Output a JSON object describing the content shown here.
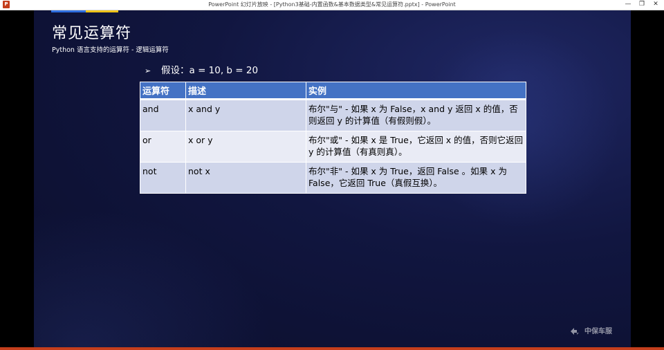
{
  "window": {
    "title": "PowerPoint 幻灯片放映 - [Python3基础-内置函数&基本数据类型&常见运算符.pptx] - PowerPoint",
    "app_icon": "P",
    "controls": {
      "minimize": "—",
      "restore": "❐",
      "close": "✕"
    }
  },
  "slide": {
    "title": "常见运算符",
    "subtitle": "Python 语言支持的运算符 - 逻辑运算符",
    "bullet": {
      "marker": "➢",
      "text": "假设：a = 10, b = 20"
    },
    "table": {
      "headers": [
        "运算符",
        "描述",
        "实例"
      ],
      "rows": [
        [
          "and",
          "x and y",
          "布尔\"与\" - 如果 x 为 False，x and y 返回 x 的值，否则返回 y 的计算值（有假则假）。"
        ],
        [
          "or",
          "x or y",
          "布尔\"或\" - 如果 x 是 True，它返回 x 的值，否则它返回 y 的计算值（有真则真）。"
        ],
        [
          "not",
          "not x",
          "布尔\"非\" - 如果 x 为 True，返回 False 。如果 x 为 False，它返回 True（真假互换）。"
        ]
      ]
    },
    "watermark": "中保车服"
  },
  "colors": {
    "header_blue": "#4472c4",
    "row_odd": "#cfd5ea",
    "row_even": "#e9ebf5",
    "accent_blue": "#2f6fe0",
    "accent_yellow": "#f0c419",
    "statusbar": "#c43e1c"
  }
}
